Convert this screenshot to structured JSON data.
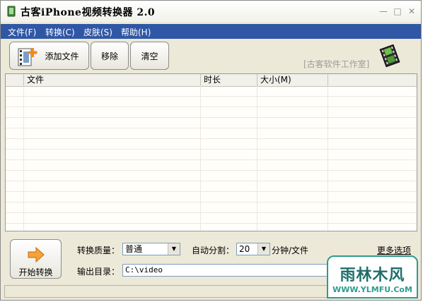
{
  "window": {
    "title": "古客iPhone视频转换器  2.0",
    "controls": [
      "minimize-icon",
      "maximize-icon",
      "close-icon"
    ]
  },
  "menu": {
    "items": [
      {
        "label": "文件(F)"
      },
      {
        "label": "转换(C)"
      },
      {
        "label": "皮肤(S)"
      },
      {
        "label": "帮助(H)"
      }
    ]
  },
  "toolbar": {
    "add_label": "添加文件",
    "remove_label": "移除",
    "clear_label": "清空",
    "studio_text": "[古客软件工作室]"
  },
  "file_list": {
    "columns": [
      "",
      "文件",
      "时长",
      "大小(M)",
      ""
    ],
    "rows": []
  },
  "bottom": {
    "start_label": "开始转换",
    "quality_label": "转换质量：",
    "quality_value": "普通",
    "split_label": "自动分割：",
    "split_value": "20",
    "split_unit": "分钟/文件",
    "more_options": "更多选项",
    "output_label": "输出目录：",
    "output_value": "C:\\video"
  },
  "watermark": {
    "text": "雨林木风",
    "url": "WWW.YLMFU.CoM"
  },
  "colors": {
    "menubar": "#2f57a6",
    "window_bg": "#ece9d8",
    "watermark": "#2f9b8e"
  }
}
